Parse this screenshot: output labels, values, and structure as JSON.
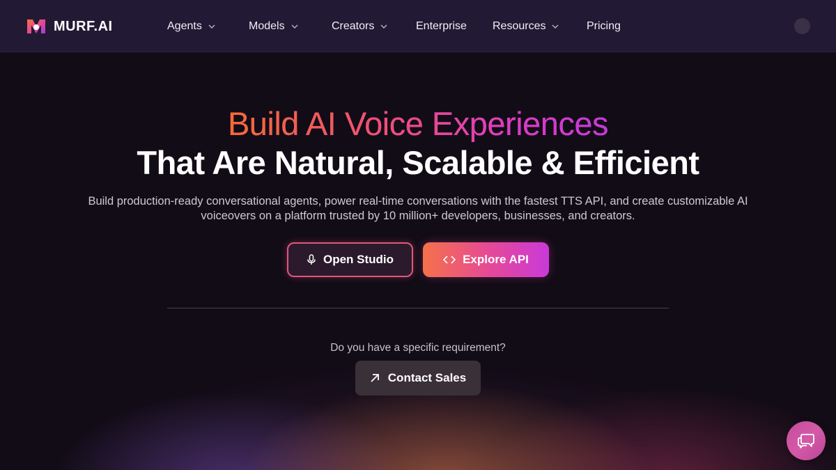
{
  "brand": {
    "name": "MURF.AI"
  },
  "nav": {
    "items": [
      {
        "label": "Agents",
        "has_dropdown": true
      },
      {
        "label": "Models",
        "has_dropdown": true
      },
      {
        "label": "Creators",
        "has_dropdown": true
      },
      {
        "label": "Enterprise",
        "has_dropdown": false
      },
      {
        "label": "Resources",
        "has_dropdown": true
      },
      {
        "label": "Pricing",
        "has_dropdown": false
      }
    ]
  },
  "hero": {
    "headline_gradient": "Build AI Voice Experiences",
    "headline_white": "That Are Natural, Scalable & Efficient",
    "subtitle": "Build production-ready conversational agents, power real-time conversations with the fastest TTS API, and create customizable AI voiceovers on a platform trusted by 10 million+ developers, businesses, and creators.",
    "primary_button": {
      "label": "Open Studio",
      "icon": "microphone-icon"
    },
    "secondary_button": {
      "label": "Explore API",
      "icon": "code-brackets-icon"
    }
  },
  "sales": {
    "question": "Do you have a specific requirement?",
    "button": {
      "label": "Contact Sales",
      "icon": "arrow-up-right-icon"
    }
  },
  "chat_widget": {
    "icon": "chat-bubbles-icon"
  },
  "colors": {
    "background": "#120c17",
    "nav_background": "#221a34",
    "gradient_start": "#f66a35",
    "gradient_mid": "#ee4e7a",
    "gradient_end": "#c33ad8",
    "chat_fab": "#c44a9c"
  }
}
